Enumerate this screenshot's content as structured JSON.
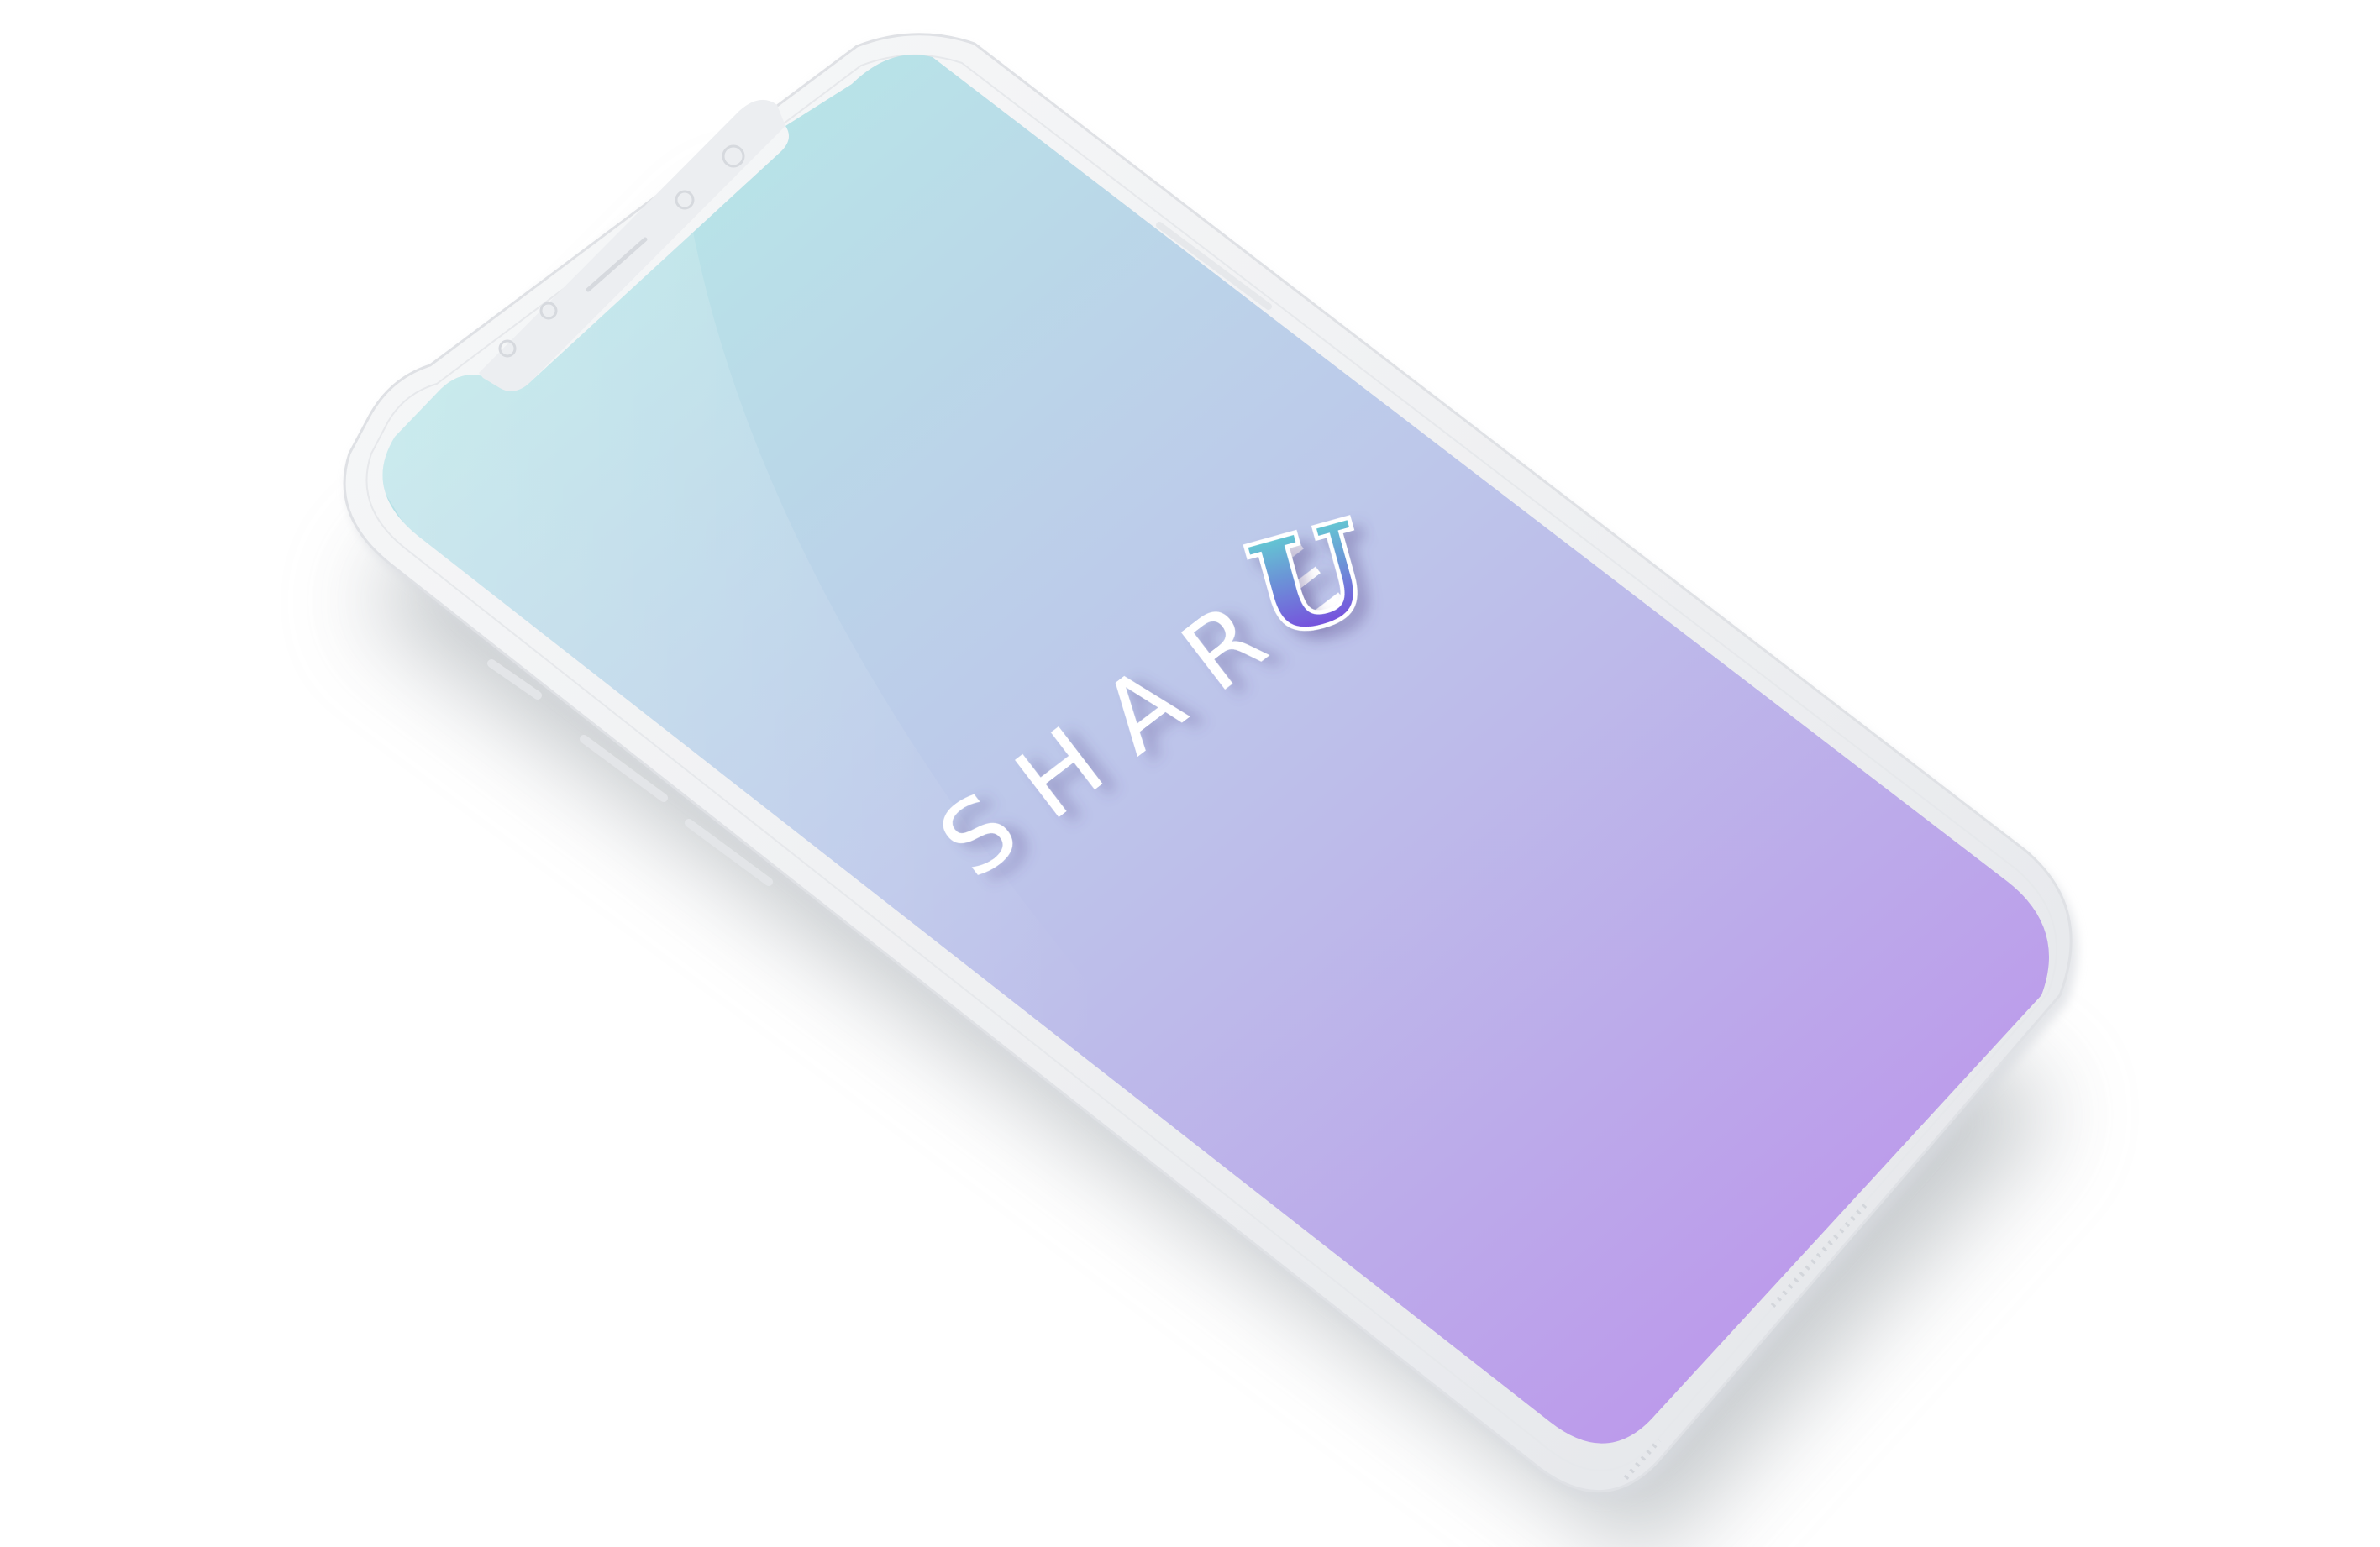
{
  "app": {
    "logo_word": "SHARE",
    "logo_monogram": "U"
  },
  "colors": {
    "screen_top_left": "#B6F0E6",
    "screen_mid": "#BDC8EA",
    "screen_bottom_right": "#BC8DEB",
    "device_body": "#F1F2F4",
    "device_edge": "#E2E4E8",
    "logo_text": "#FFFFFF",
    "monogram_top": "#5FE3D0",
    "monogram_bottom": "#7B2FE0"
  },
  "icons": [
    "front-camera-icon",
    "earpiece-speaker-icon",
    "proximity-sensor-icon"
  ]
}
